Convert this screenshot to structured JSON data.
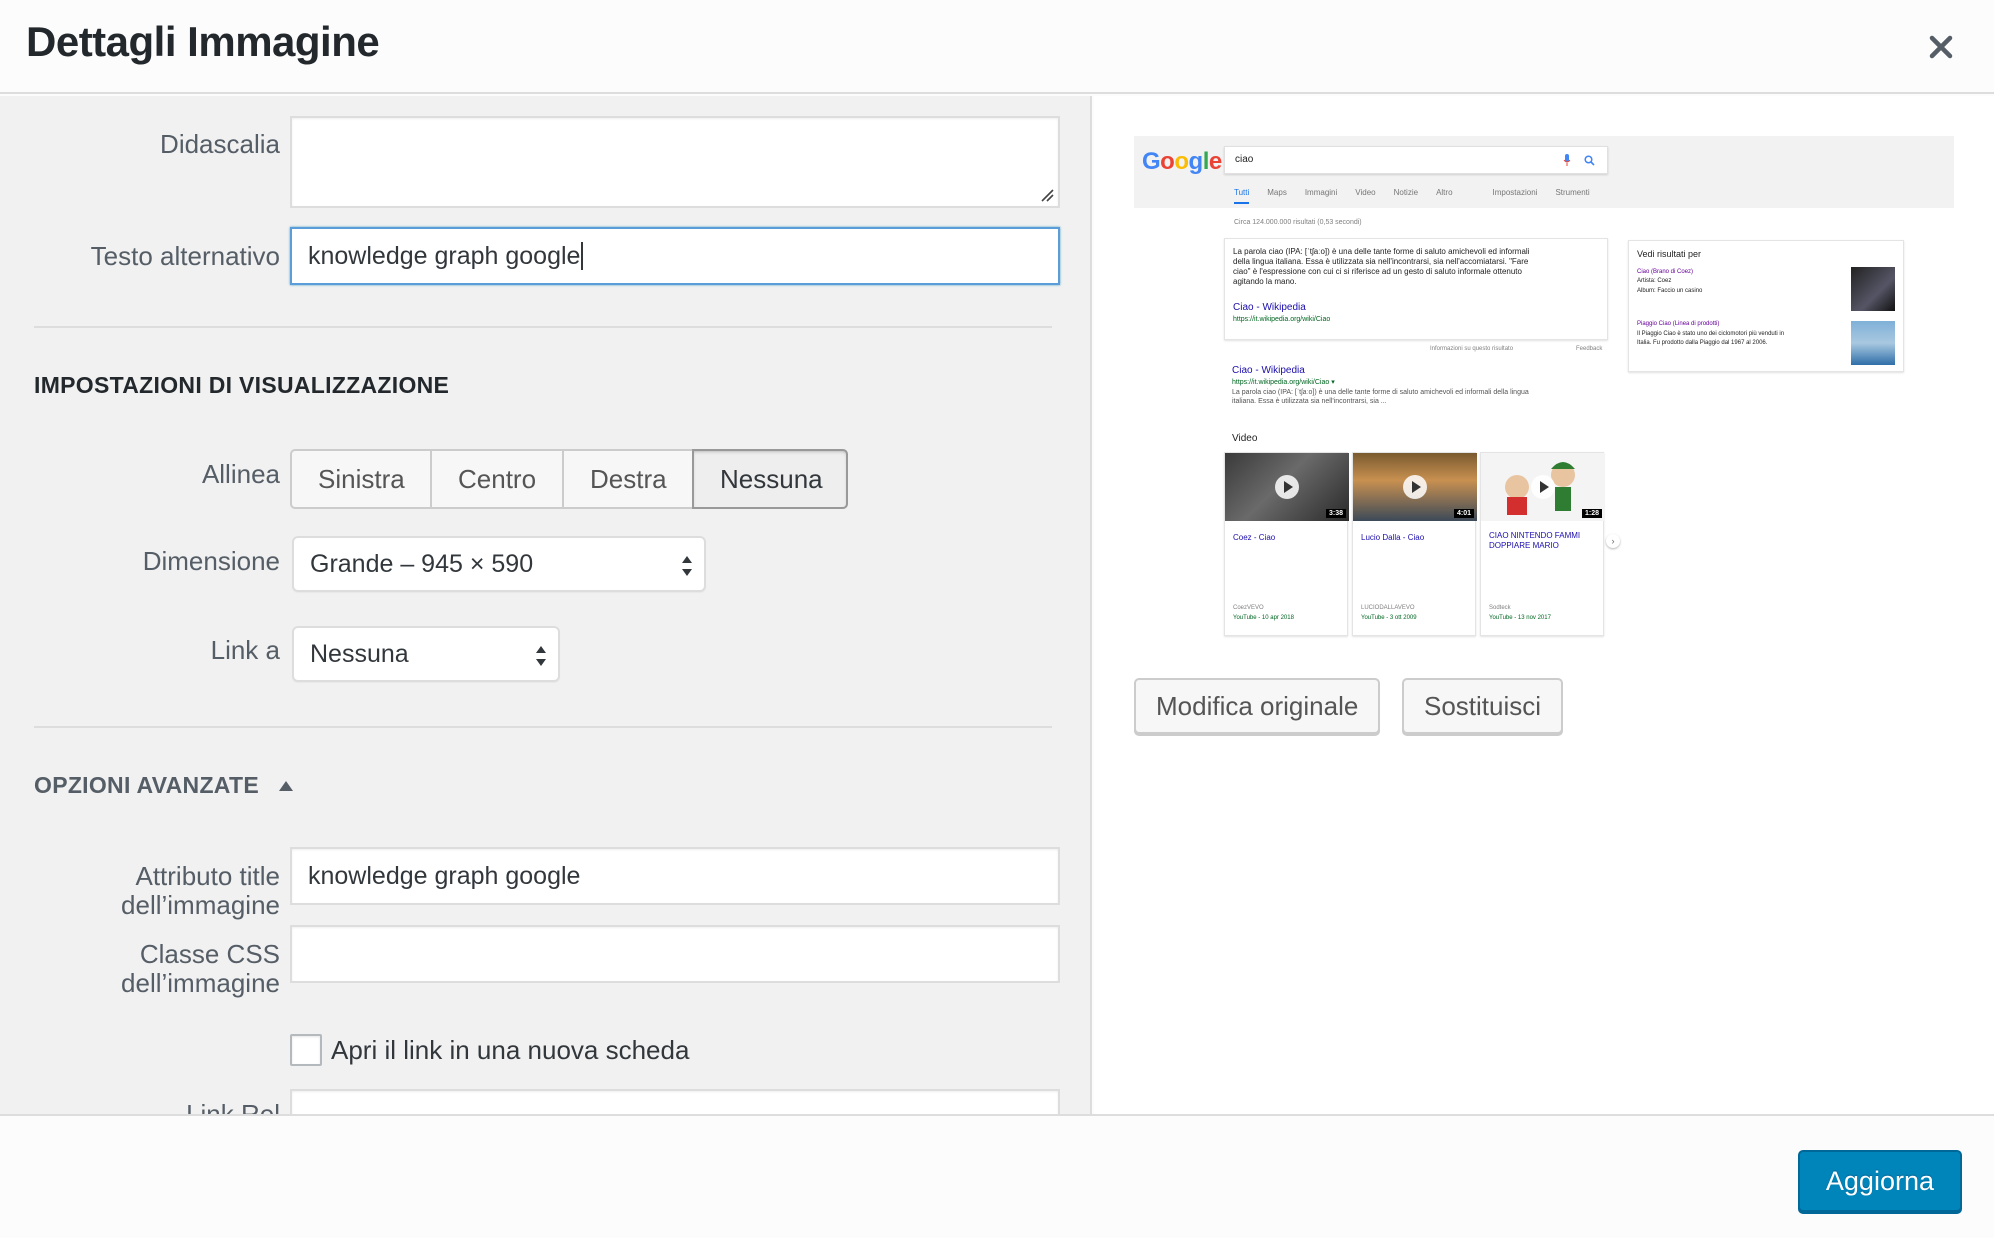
{
  "header": {
    "title": "Dettagli Immagine"
  },
  "form": {
    "caption": {
      "label": "Didascalia",
      "value": ""
    },
    "alt_text": {
      "label": "Testo alternativo",
      "value": "knowledge graph google"
    },
    "display_settings": {
      "title": "IMPOSTAZIONI DI VISUALIZZAZIONE",
      "align": {
        "label": "Allinea",
        "options": [
          "Sinistra",
          "Centro",
          "Destra",
          "Nessuna"
        ],
        "selected": "Nessuna"
      },
      "size": {
        "label": "Dimensione",
        "value": "Grande – 945 × 590"
      },
      "link_to": {
        "label": "Link a",
        "value": "Nessuna"
      }
    },
    "advanced": {
      "title": "OPZIONI AVANZATE",
      "image_title": {
        "label_1": "Attributo title",
        "label_2": "dell’immagine",
        "value": "knowledge graph google"
      },
      "css_class": {
        "label_1": "Classe CSS",
        "label_2": "dell’immagine",
        "value": ""
      },
      "new_tab": {
        "label": "Apri il link in una nuova scheda",
        "checked": false
      },
      "link_rel": {
        "label": "Link Rel",
        "value": ""
      }
    }
  },
  "preview": {
    "google": {
      "logo": "Google",
      "query": "ciao",
      "tabs": [
        "Tutti",
        "Maps",
        "Immagini",
        "Video",
        "Notizie",
        "Altro",
        "Impostazioni",
        "Strumenti"
      ],
      "result_count": "Circa 124.000.000 risultati (0,53 secondi)",
      "featured_line_1": "La parola ciao (IPA: [ˈtʃaːo]) è una delle tante forme di saluto amichevoli ed informali",
      "featured_line_2": "della lingua italiana. Essa è utilizzata sia nell'incontrarsi, sia nell'accomiatarsi. \"Fare",
      "featured_line_3": "ciao\" è l'espressione con cui ci si riferisce ad un gesto di saluto informale ottenuto",
      "featured_line_4": "agitando la mano.",
      "featured_link": "Ciao - Wikipedia",
      "featured_url": "https://it.wikipedia.org/wiki/Ciao",
      "feedback_1": "Informazioni su questo risultato",
      "feedback_2": "Feedback",
      "result_title": "Ciao - Wikipedia",
      "result_url": "https://it.wikipedia.org/wiki/Ciao ▾",
      "result_snippet_1": "La parola ciao (IPA: [ˈtʃaːo]) è una delle tante forme di saluto amichevoli ed informali della lingua",
      "result_snippet_2": "italiana. Essa è utilizzata sia nell'incontrarsi, sia ...",
      "video_heading": "Video",
      "videos": [
        {
          "title": "Coez - Ciao",
          "channel": "CoezVEVO",
          "meta": "YouTube - 10 apr 2018",
          "duration": "3:38"
        },
        {
          "title": "Lucio Dalla - Ciao",
          "channel": "LUCIODALLAVEVO",
          "meta": "YouTube - 3 ott 2009",
          "duration": "4:01"
        },
        {
          "title": "CIAO NINTENDO FAMMI DOPPIARE MARIO",
          "channel": "Sodteck",
          "meta": "YouTube - 13 nov 2017",
          "duration": "1:28"
        }
      ],
      "side_title": "Vedi risultati per",
      "side_1_title": "Ciao (Brano di Coez)",
      "side_1_a": "Artista: Coez",
      "side_1_b": "Album: Faccio un casino",
      "side_2_title": "Piaggio Ciao (Linea di prodotti)",
      "side_2_a": "Il Piaggio Ciao è stato uno dei ciclomotori più venduti in",
      "side_2_b": "Italia. Fu prodotto dalla Piaggio dal 1967 al 2006."
    },
    "edit_original_label": "Modifica originale",
    "replace_label": "Sostituisci"
  },
  "footer": {
    "update_label": "Aggiorna"
  },
  "colors": {
    "primary": "#0085ba",
    "focus": "#5b9dd9",
    "panel": "#f1f1f1"
  }
}
